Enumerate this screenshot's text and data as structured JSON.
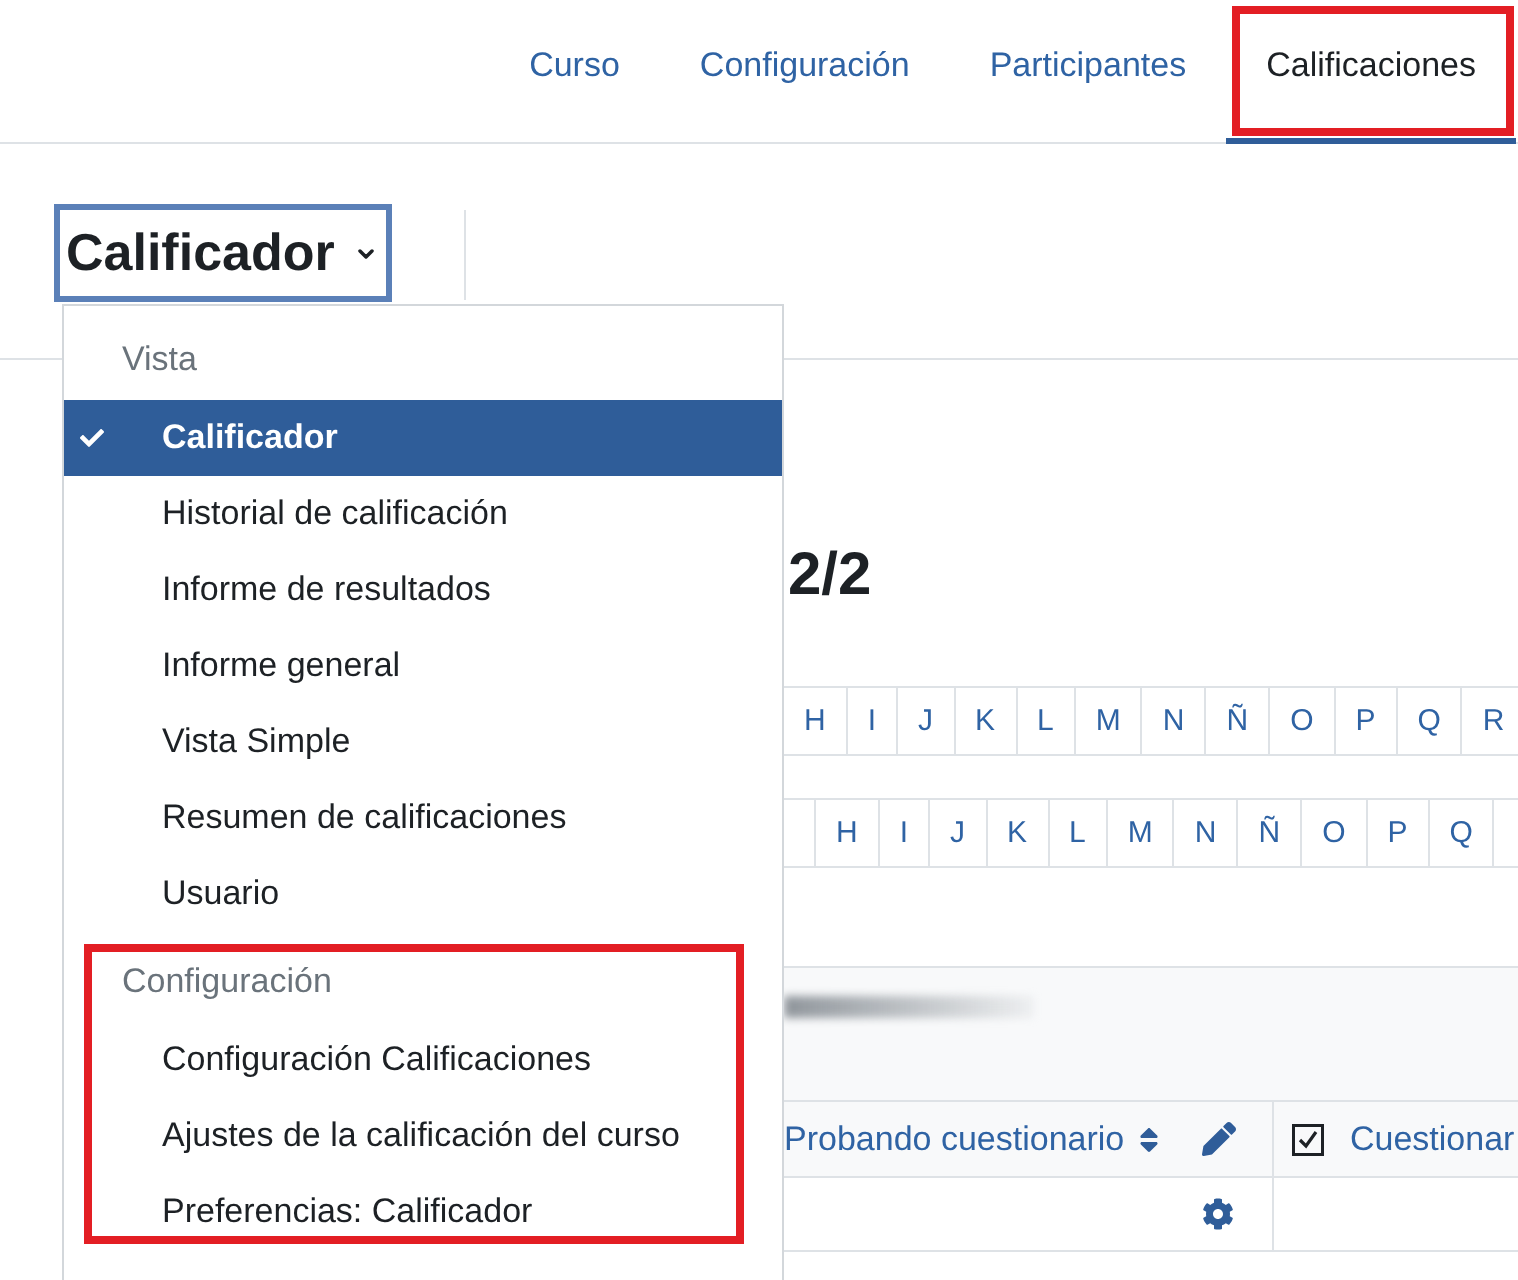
{
  "nav": {
    "tabs": [
      {
        "label": "Curso",
        "selected": false,
        "highlighted": false
      },
      {
        "label": "Configuración",
        "selected": false,
        "highlighted": false
      },
      {
        "label": "Participantes",
        "selected": false,
        "highlighted": false
      },
      {
        "label": "Calificaciones",
        "selected": true,
        "highlighted": true
      }
    ]
  },
  "report_selector": {
    "label": "Calificador"
  },
  "menu": {
    "sections": [
      {
        "heading": "Vista",
        "highlighted": false,
        "items": [
          {
            "label": "Calificador",
            "selected": true
          },
          {
            "label": "Historial de calificación",
            "selected": false
          },
          {
            "label": "Informe de resultados",
            "selected": false
          },
          {
            "label": "Informe general",
            "selected": false
          },
          {
            "label": "Vista Simple",
            "selected": false
          },
          {
            "label": "Resumen de calificaciones",
            "selected": false
          },
          {
            "label": "Usuario",
            "selected": false
          }
        ]
      },
      {
        "heading": "Configuración",
        "highlighted": true,
        "items": [
          {
            "label": "Configuración Calificaciones",
            "selected": false
          },
          {
            "label": "Ajustes de la calificación del curso",
            "selected": false
          },
          {
            "label": "Preferencias: Calificador",
            "selected": false
          }
        ]
      }
    ]
  },
  "heading": "2/2",
  "letter_filters": [
    {
      "letters": [
        "H",
        "I",
        "J",
        "K",
        "L",
        "M",
        "N",
        "Ñ",
        "O",
        "P",
        "Q",
        "R"
      ]
    },
    {
      "letters": [
        "H",
        "I",
        "J",
        "K",
        "L",
        "M",
        "N",
        "Ñ",
        "O",
        "P",
        "Q"
      ]
    }
  ],
  "table": {
    "columns": [
      {
        "label": "Probando cuestionario",
        "kind": "category"
      },
      {
        "label": "Cuestionar",
        "kind": "activity"
      }
    ]
  }
}
